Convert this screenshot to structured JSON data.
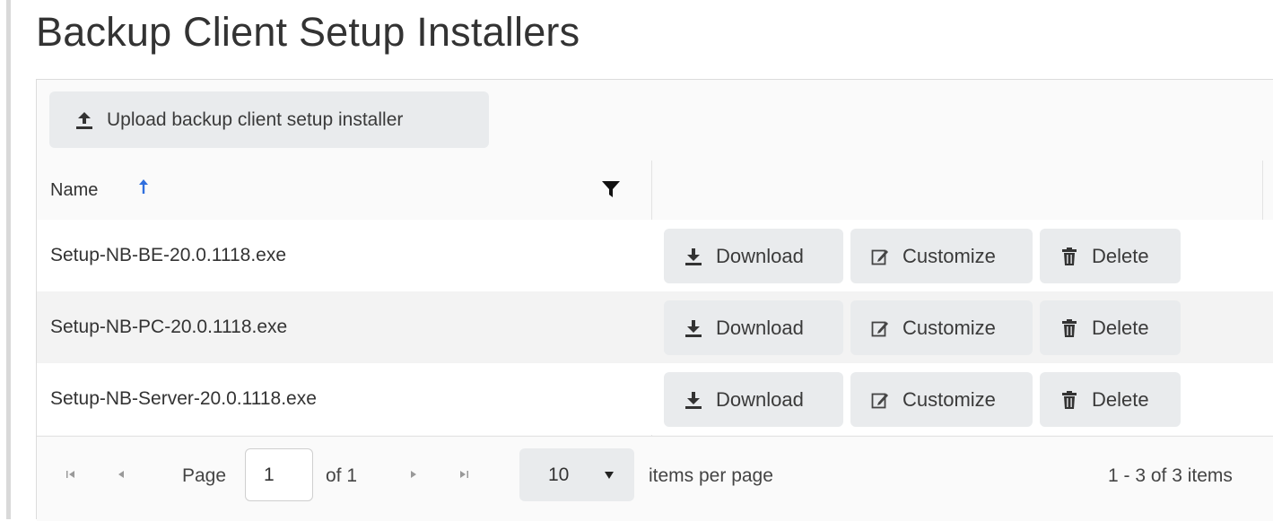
{
  "page_title": "Backup Client Setup Installers",
  "toolbar": {
    "upload_label": "Upload backup client setup installer",
    "upload_icon": "upload-icon"
  },
  "grid": {
    "columns": {
      "name": "Name"
    },
    "sort": {
      "column": "Name",
      "direction": "ascending",
      "color": "#2f6fde"
    },
    "rows": [
      {
        "name": "Setup-NB-BE-20.0.1118.exe"
      },
      {
        "name": "Setup-NB-PC-20.0.1118.exe"
      },
      {
        "name": "Setup-NB-Server-20.0.1118.exe"
      }
    ],
    "actions": {
      "download": "Download",
      "customize": "Customize",
      "delete": "Delete"
    }
  },
  "pager": {
    "page_label": "Page",
    "current_page": "1",
    "of_label": "of 1",
    "page_size": "10",
    "items_per_page_label": "items per page",
    "summary": "1 - 3 of 3 items"
  }
}
